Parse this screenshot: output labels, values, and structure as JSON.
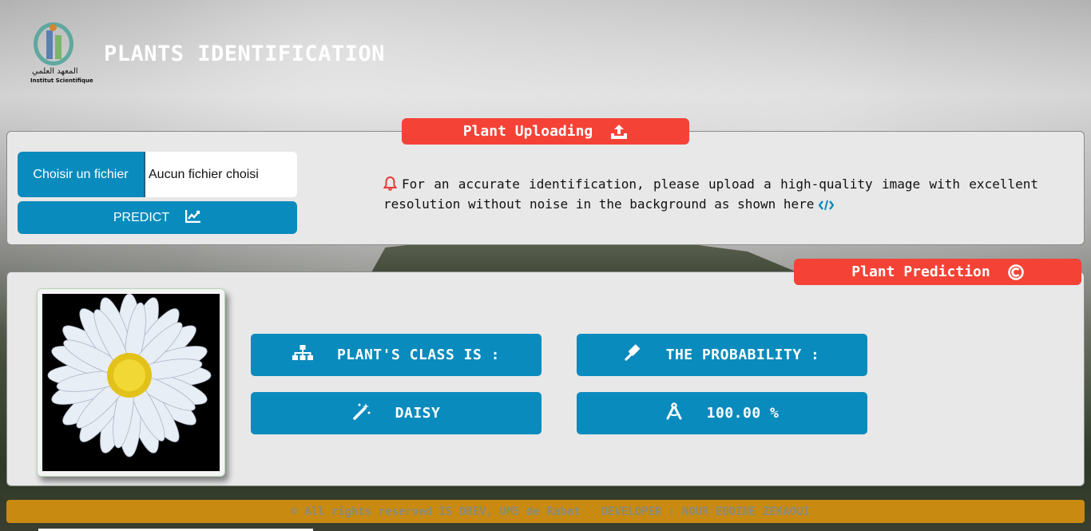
{
  "header": {
    "logo_arabic": "المعهد العلمي",
    "logo_french": "Institut Scientifique",
    "title": "PLANTS IDENTIFICATION"
  },
  "upload": {
    "tag_label": "Plant Uploading",
    "tag_icon": "upload-icon",
    "file_button_label": "Choisir un fichier",
    "file_status": "Aucun fichier choisi",
    "predict_label": "PREDICT",
    "predict_icon": "chart-line-icon",
    "notice": "For an accurate identification, please upload a high-quality image with excellent resolution without noise in the background as shown here"
  },
  "prediction": {
    "tag_label": "Plant Prediction",
    "class_label": "PLANT'S CLASS IS :",
    "probability_label": "THE PROBABILITY :",
    "class_value": "DAISY",
    "probability_value": "100.00 %"
  },
  "footer": {
    "copyright": "© All rights reserved IS DBEV, UM5 de Rabat",
    "developer": "DEVELOPER : NOUR EDDINE ZEKAOUI"
  },
  "colors": {
    "accent_blue": "#0a8bbd",
    "tag_red": "#f44336",
    "footer_gold": "#c88a10"
  }
}
